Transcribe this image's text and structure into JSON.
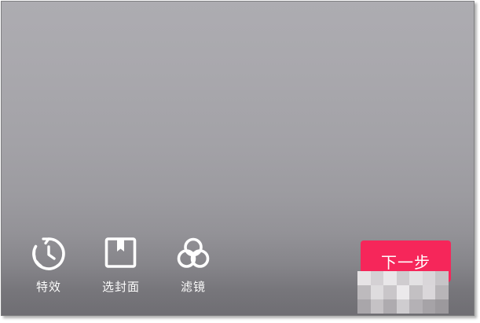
{
  "toolbar": {
    "effects": {
      "label": "特效",
      "icon": "effects-timer-icon"
    },
    "cover": {
      "label": "选封面",
      "icon": "bookmark-cover-icon"
    },
    "filter": {
      "label": "滤镜",
      "icon": "filter-circles-icon"
    }
  },
  "next_button": {
    "label": "下一步"
  },
  "colors": {
    "accent": "#f6265a",
    "icon": "#ffffff",
    "background_top": "#adacb1",
    "background_bottom": "#6f6e73"
  },
  "watermark": {
    "type": "pixelated-mosaic"
  }
}
